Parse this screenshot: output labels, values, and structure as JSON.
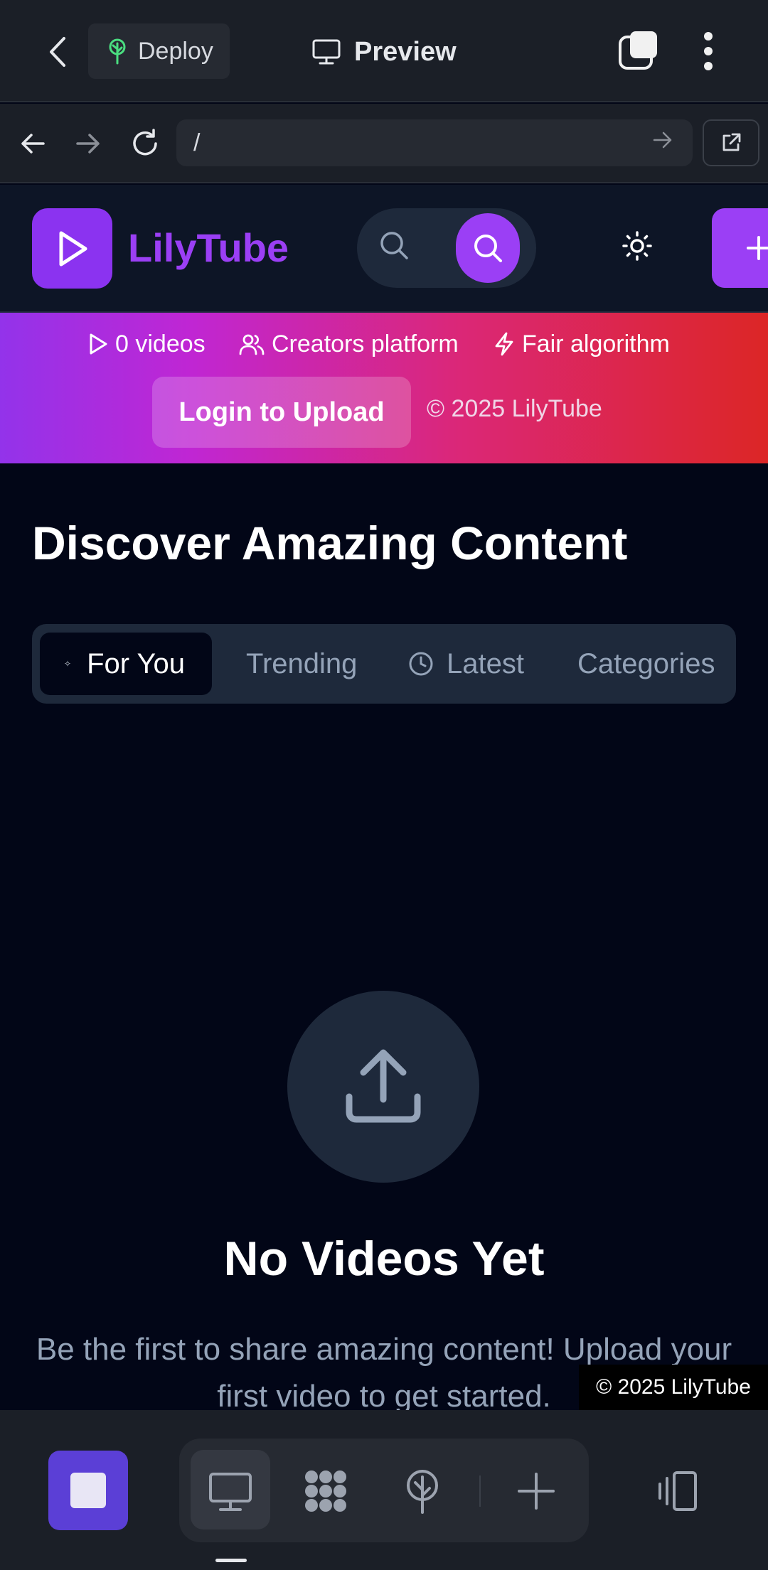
{
  "appbar": {
    "deploy_label": "Deploy",
    "preview_label": "Preview"
  },
  "browser": {
    "url": "/"
  },
  "site": {
    "brand": "LilyTube",
    "stats": {
      "videos": "0 videos",
      "creators": "Creators platform",
      "algorithm": "Fair algorithm"
    },
    "login_button": "Login to Upload",
    "banner_copyright": "© 2025 LilyTube",
    "heading": "Discover Amazing Content",
    "tabs": {
      "for_you": "For You",
      "trending": "Trending",
      "latest": "Latest",
      "categories": "Categories"
    },
    "empty": {
      "title": "No Videos Yet",
      "description": "Be the first to share amazing content! Upload your first video to get started."
    },
    "footer_copyright": "© 2025 LilyTube"
  },
  "colors": {
    "brand_purple": "#9b3ff5",
    "background": "#020617",
    "surface": "#1e293b",
    "muted_text": "#94a3b8",
    "banner_gradient_start": "#9333ea",
    "banner_gradient_end": "#dc2626",
    "stop_button": "#5b3fd6"
  },
  "icons": {
    "back": "chevron-left-icon",
    "deploy": "tree-icon",
    "preview": "monitor-icon",
    "tabs": "tabs-icon",
    "more": "more-vertical-icon",
    "nav_back": "arrow-left-icon",
    "nav_forward": "arrow-right-icon",
    "reload": "reload-icon",
    "open_external": "external-link-icon",
    "logo": "play-icon",
    "search": "search-icon",
    "theme": "sun-icon",
    "add": "plus-icon",
    "upload": "upload-icon"
  }
}
